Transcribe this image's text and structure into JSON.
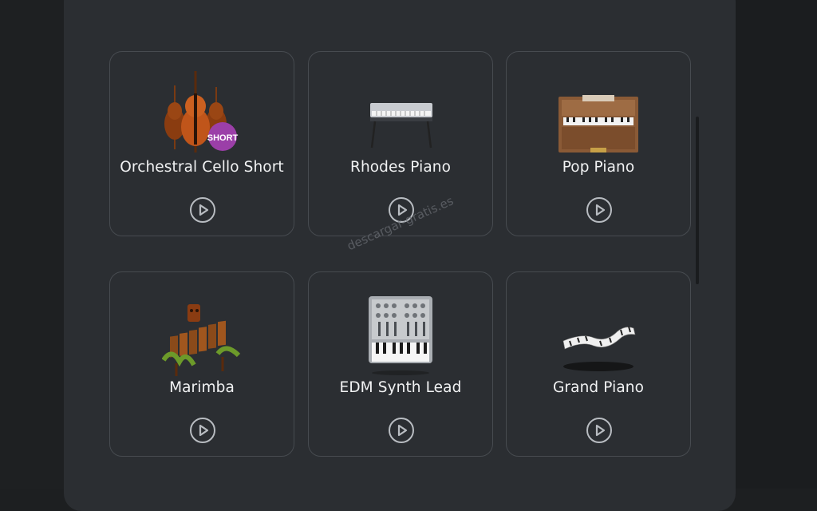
{
  "instruments": [
    {
      "label": "Orchestral Cello Short",
      "art_icon": "cello-icon",
      "badge": "SHORT"
    },
    {
      "label": "Rhodes Piano",
      "art_icon": "electric-piano-icon"
    },
    {
      "label": "Pop Piano",
      "art_icon": "upright-piano-icon"
    },
    {
      "label": "Marimba",
      "art_icon": "marimba-icon"
    },
    {
      "label": "EDM Synth Lead",
      "art_icon": "synthesizer-icon"
    },
    {
      "label": "Grand Piano",
      "art_icon": "flying-keyboard-icon"
    }
  ],
  "watermark": "descargar-gratis.es",
  "colors": {
    "panel": "#2b2e32",
    "card_border": "#474b50",
    "badge": "#9b3fa8",
    "text": "#f1f2f3"
  }
}
